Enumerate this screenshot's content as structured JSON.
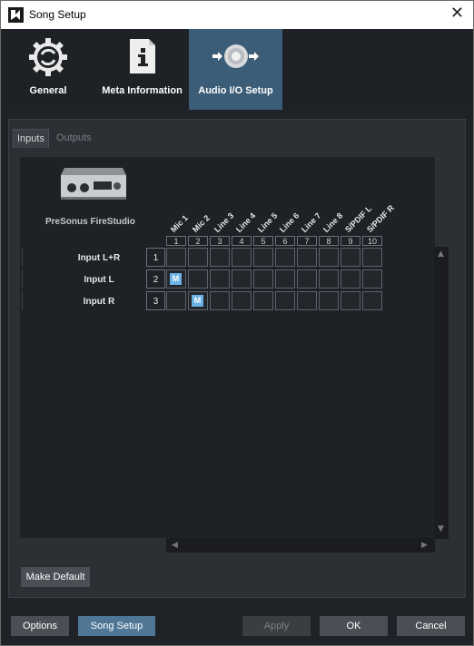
{
  "window": {
    "title": "Song Setup",
    "close_glyph": "✕"
  },
  "topbar": {
    "items": [
      {
        "label": "General",
        "icon": "gear-icon"
      },
      {
        "label": "Meta Information",
        "icon": "info-document-icon"
      },
      {
        "label": "Audio I/O Setup",
        "icon": "audio-io-icon",
        "active": true
      }
    ]
  },
  "tabs": [
    {
      "label": "Inputs",
      "active": true
    },
    {
      "label": "Outputs",
      "active": false
    }
  ],
  "device": {
    "name": "PreSonus FireStudio"
  },
  "channels": [
    {
      "num": "1",
      "name": "Mic 1"
    },
    {
      "num": "2",
      "name": "Mic 2"
    },
    {
      "num": "3",
      "name": "Line 3"
    },
    {
      "num": "4",
      "name": "Line 4"
    },
    {
      "num": "5",
      "name": "Line 5"
    },
    {
      "num": "6",
      "name": "Line 6"
    },
    {
      "num": "7",
      "name": "Line 7"
    },
    {
      "num": "8",
      "name": "Line 8"
    },
    {
      "num": "9",
      "name": "S/PDIF L"
    },
    {
      "num": "10",
      "name": "S/PDIF R"
    }
  ],
  "inputs": [
    {
      "num": "1",
      "name": "Input L+R",
      "assigned": []
    },
    {
      "num": "2",
      "name": "Input L",
      "assigned": [
        1
      ]
    },
    {
      "num": "3",
      "name": "Input R",
      "assigned": [
        2
      ]
    }
  ],
  "mono_marker": "M",
  "buttons": {
    "make_default": "Make Default",
    "options": "Options",
    "song_setup": "Song Setup",
    "apply": "Apply",
    "ok": "OK",
    "cancel": "Cancel"
  },
  "colors": {
    "active_tab": "#3c5d77",
    "assigned_marker": "#6ab3e6",
    "song_setup_button": "#4f7694"
  }
}
